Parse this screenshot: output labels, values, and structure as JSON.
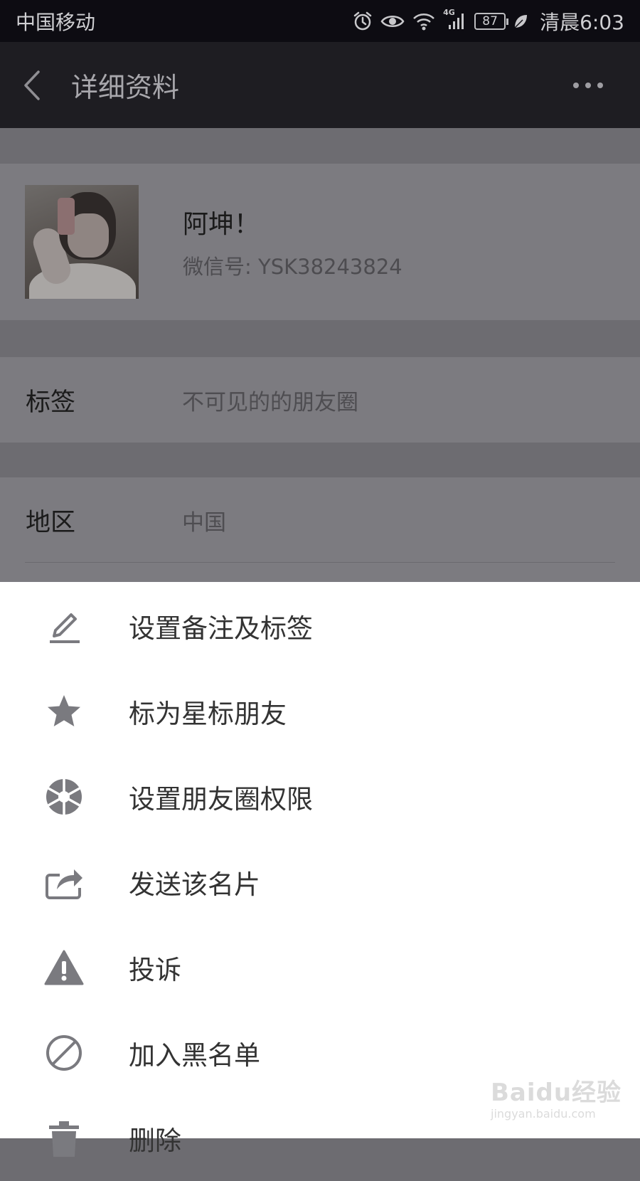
{
  "status_bar": {
    "carrier": "中国移动",
    "network": "4G",
    "battery": "87",
    "time": "清晨6:03"
  },
  "nav": {
    "title": "详细资料"
  },
  "profile": {
    "name": "阿坤！",
    "wechat_id": "微信号: YSK38243824"
  },
  "info_rows": [
    {
      "label": "标签",
      "value": "不可见的的朋友圈"
    },
    {
      "label": "地区",
      "value": "中国"
    }
  ],
  "menu": [
    {
      "label": "设置备注及标签",
      "icon": "edit-pencil-icon"
    },
    {
      "label": "标为星标朋友",
      "icon": "star-icon"
    },
    {
      "label": "设置朋友圈权限",
      "icon": "aperture-icon"
    },
    {
      "label": "发送该名片",
      "icon": "share-icon"
    },
    {
      "label": "投诉",
      "icon": "warning-icon"
    },
    {
      "label": "加入黑名单",
      "icon": "block-icon"
    },
    {
      "label": "删除",
      "icon": "trash-icon"
    }
  ],
  "watermark": {
    "text": "Baidu经验",
    "url": "jingyan.baidu.com"
  },
  "colors": {
    "status_bar_bg": "#0d0c12",
    "nav_bar_bg": "#1e1d22",
    "overlay_bg": "#6d6c71",
    "sheet_bg": "#ffffff",
    "icon_gray": "#7a7a7f"
  }
}
